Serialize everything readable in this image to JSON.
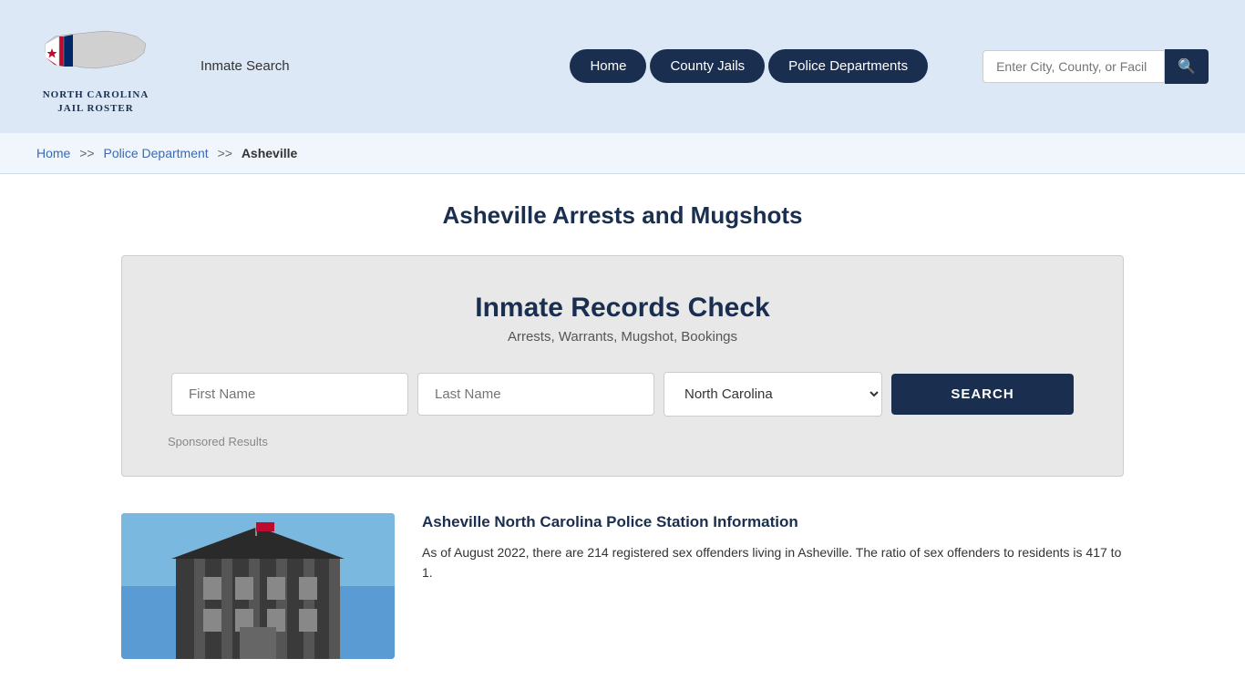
{
  "site": {
    "logo_line1": "NORTH CAROLINA",
    "logo_line2": "JAIL ROSTER"
  },
  "header": {
    "inmate_search_label": "Inmate Search",
    "nav_buttons": [
      {
        "id": "home",
        "label": "Home"
      },
      {
        "id": "county-jails",
        "label": "County Jails"
      },
      {
        "id": "police-departments",
        "label": "Police Departments"
      }
    ],
    "search_placeholder": "Enter City, County, or Facil"
  },
  "breadcrumb": {
    "home_label": "Home",
    "sep1": ">>",
    "police_dept_label": "Police Department",
    "sep2": ">>",
    "current": "Asheville"
  },
  "main": {
    "page_title": "Asheville Arrests and Mugshots"
  },
  "records_box": {
    "title": "Inmate Records Check",
    "subtitle": "Arrests, Warrants, Mugshot, Bookings",
    "first_name_placeholder": "First Name",
    "last_name_placeholder": "Last Name",
    "state_default": "North Carolina",
    "search_button_label": "SEARCH",
    "sponsored_label": "Sponsored Results"
  },
  "station": {
    "title": "Asheville North Carolina Police Station Information",
    "description": "As of August 2022, there are 214 registered sex offenders living in Asheville. The ratio of sex offenders to residents is 417 to 1."
  }
}
